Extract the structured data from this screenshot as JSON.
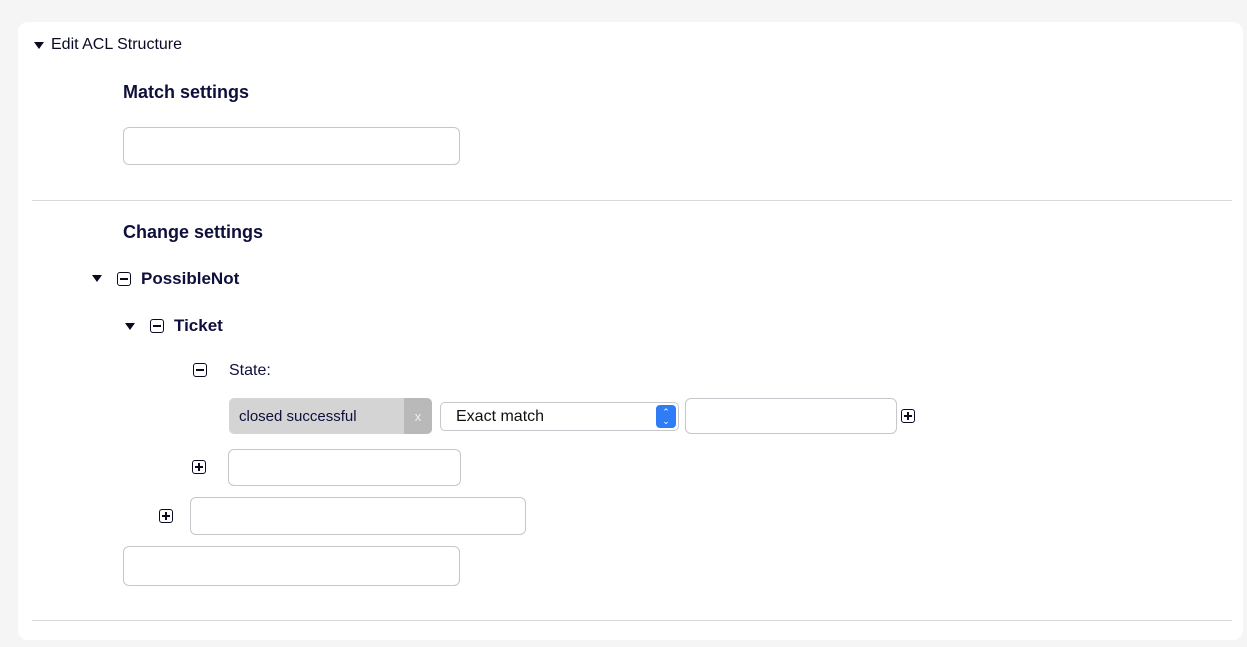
{
  "section": {
    "toggle_label": "Edit ACL Structure"
  },
  "match": {
    "heading": "Match settings",
    "input_value": ""
  },
  "change": {
    "heading": "Change settings",
    "node": {
      "label": "PossibleNot",
      "child": {
        "label": "Ticket",
        "field": {
          "label": "State:",
          "value_chip": "closed successful",
          "chip_remove": "x",
          "match_type": "Exact match",
          "match_type_arrows": [
            "⌃",
            "⌄"
          ],
          "value_input": ""
        },
        "add_field_input": ""
      },
      "add_child_input": ""
    },
    "add_node_input": ""
  },
  "icons": {
    "collapse": "minus-square-icon",
    "expand": "plus-square-icon",
    "toggle": "caret-down-icon"
  }
}
